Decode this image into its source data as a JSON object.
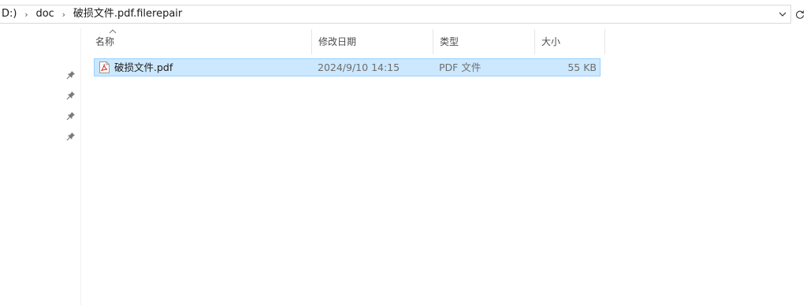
{
  "address": {
    "crumbs": [
      "D:)",
      "doc",
      "破损文件.pdf.filerepair"
    ],
    "separator": "›"
  },
  "columns": {
    "name": "名称",
    "modified": "修改日期",
    "type": "类型",
    "size": "大小"
  },
  "files": [
    {
      "name": "破损文件.pdf",
      "modified": "2024/9/10 14:15",
      "type": "PDF 文件",
      "size": "55 KB",
      "icon": "pdf-file-icon",
      "selected": true
    }
  ],
  "colors": {
    "selection_bg": "#cce8ff",
    "selection_border": "#99d1ff",
    "pdf_icon_red": "#d9302a"
  }
}
